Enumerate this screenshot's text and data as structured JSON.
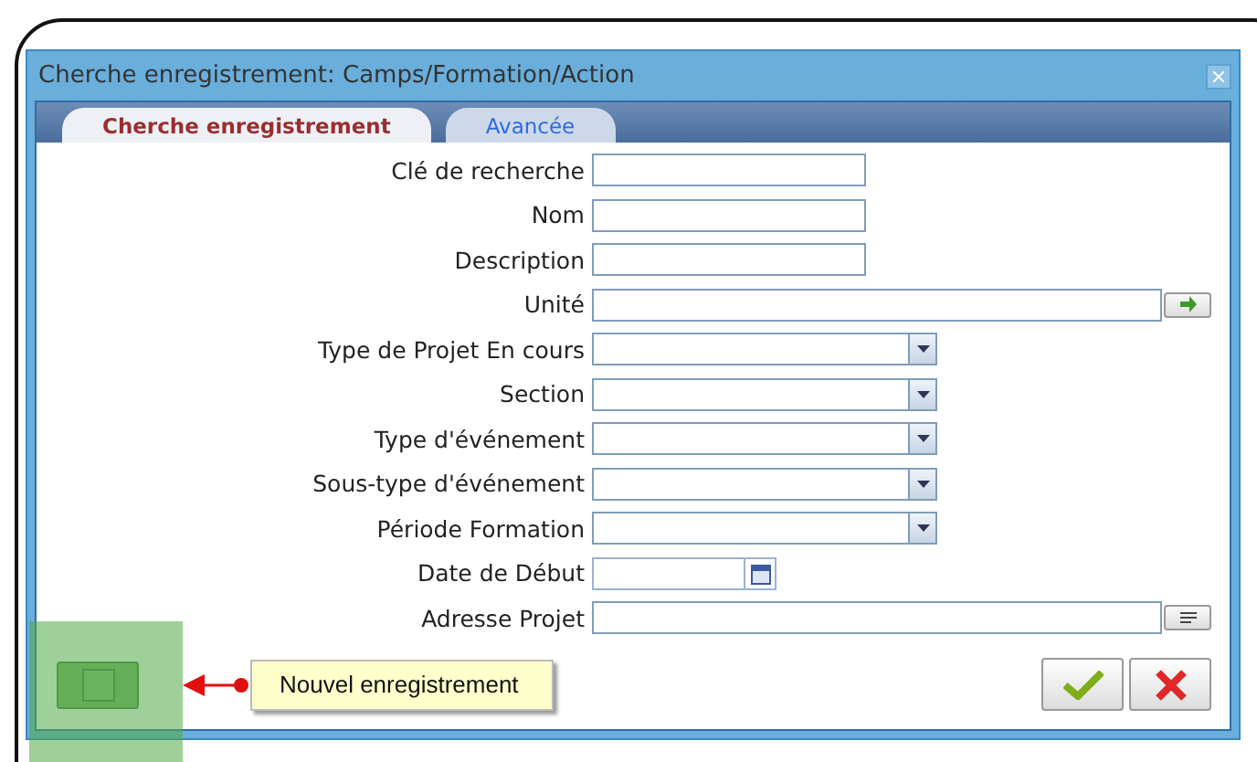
{
  "window": {
    "title": "Cherche enregistrement: Camps/Formation/Action"
  },
  "tabs": [
    {
      "label": "Cherche enregistrement",
      "selected": true
    },
    {
      "label": "Avancée",
      "selected": false
    }
  ],
  "fields": [
    {
      "label": "Clé de recherche",
      "kind": "text"
    },
    {
      "label": "Nom",
      "kind": "text"
    },
    {
      "label": "Description",
      "kind": "text"
    },
    {
      "label": "Unité",
      "kind": "lookup"
    },
    {
      "label": "Type de Projet En cours",
      "kind": "select"
    },
    {
      "label": "Section",
      "kind": "select"
    },
    {
      "label": "Type d'événement",
      "kind": "select"
    },
    {
      "label": "Sous-type d'événement",
      "kind": "select"
    },
    {
      "label": "Période Formation",
      "kind": "select"
    },
    {
      "label": "Date de Début",
      "kind": "date"
    },
    {
      "label": "Adresse Projet",
      "kind": "browse"
    }
  ],
  "tooltip": {
    "text": "Nouvel enregistrement"
  }
}
